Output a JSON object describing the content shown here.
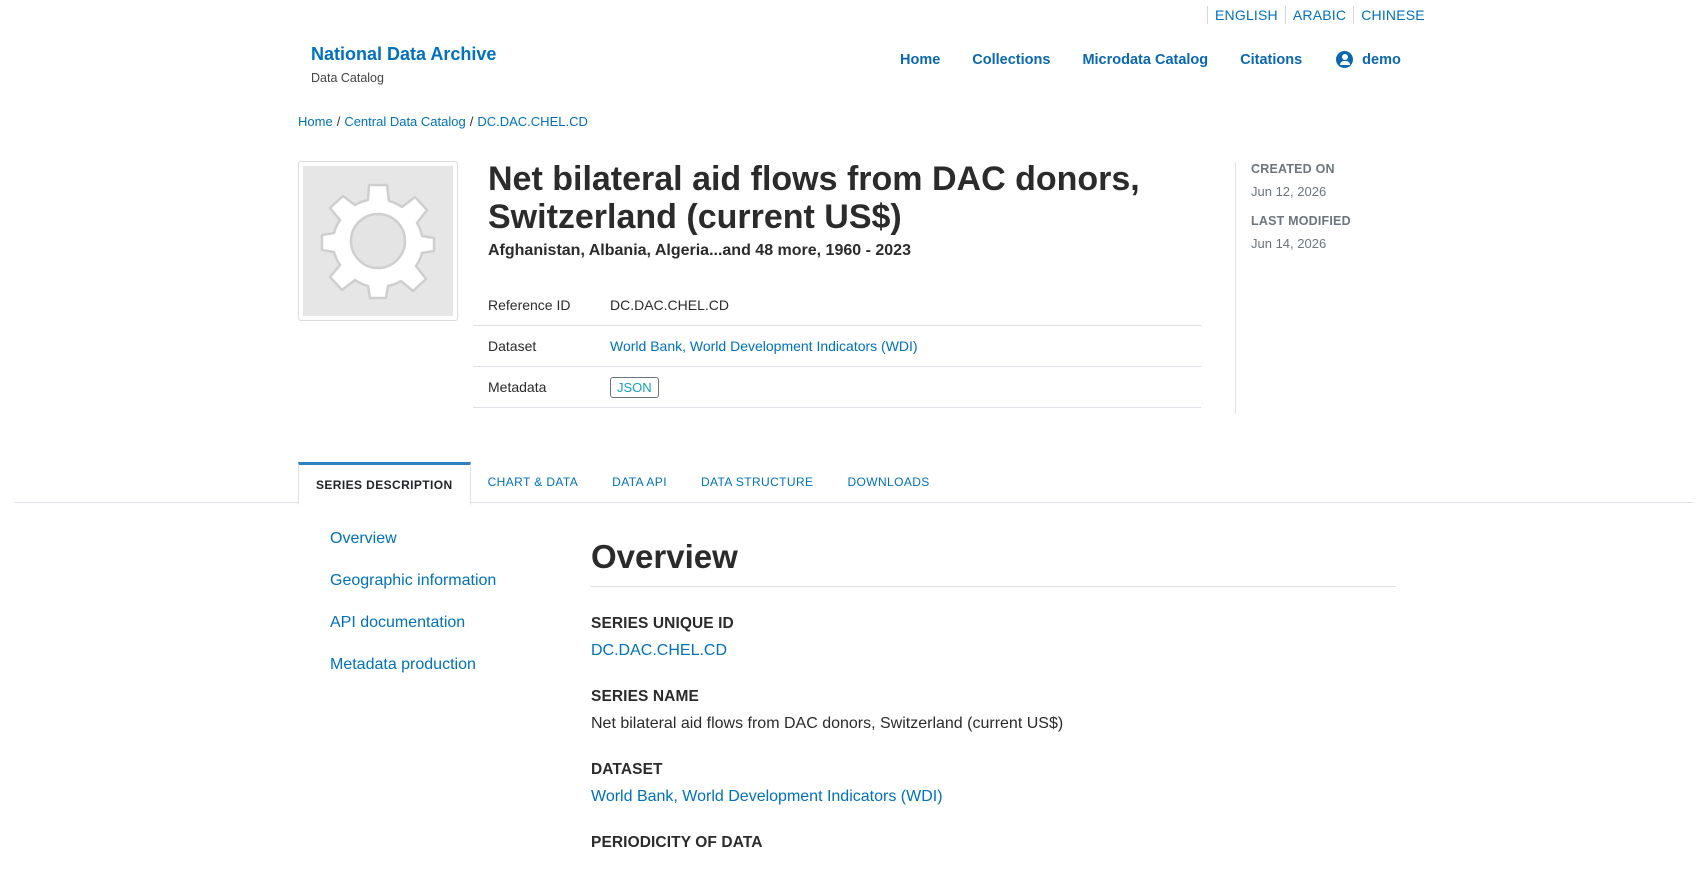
{
  "languages": [
    "ENGLISH",
    "ARABIC",
    "CHINESE"
  ],
  "brand": {
    "title": "National Data Archive",
    "subtitle": "Data Catalog"
  },
  "nav": {
    "home": "Home",
    "collections": "Collections",
    "microdata": "Microdata Catalog",
    "citations": "Citations",
    "user": "demo"
  },
  "breadcrumb": {
    "home": "Home",
    "catalog": "Central Data Catalog",
    "current": "DC.DAC.CHEL.CD"
  },
  "series": {
    "title": "Net bilateral aid flows from DAC donors, Switzerland (current US$)",
    "subtitle": "Afghanistan, Albania, Algeria...and 48 more, 1960 - 2023"
  },
  "meta": {
    "ref_label": "Reference ID",
    "ref_value": "DC.DAC.CHEL.CD",
    "dataset_label": "Dataset",
    "dataset_value": "World Bank, World Development Indicators (WDI)",
    "metadata_label": "Metadata",
    "metadata_value": "JSON"
  },
  "dates": {
    "created_label": "CREATED ON",
    "created_value": "Jun 12, 2026",
    "modified_label": "LAST MODIFIED",
    "modified_value": "Jun 14, 2026"
  },
  "tabs": [
    "SERIES DESCRIPTION",
    "CHART & DATA",
    "DATA API",
    "DATA STRUCTURE",
    "DOWNLOADS"
  ],
  "side_nav": [
    "Overview",
    "Geographic information",
    "API documentation",
    "Metadata production"
  ],
  "content": {
    "heading": "Overview",
    "uid_label": "SERIES UNIQUE ID",
    "uid_value": "DC.DAC.CHEL.CD",
    "name_label": "SERIES NAME",
    "name_value": "Net bilateral aid flows from DAC donors, Switzerland (current US$)",
    "dataset_label": "DATASET",
    "dataset_value": "World Bank, World Development Indicators (WDI)",
    "periodicity_label": "PERIODICITY OF DATA"
  },
  "colors": {
    "link": "#0071bc",
    "tab_active_border": "#2f7fc1",
    "json_badge": "#17a2b8"
  },
  "icons": {
    "user": "user-circle-icon",
    "thumbnail": "gear-icon"
  }
}
